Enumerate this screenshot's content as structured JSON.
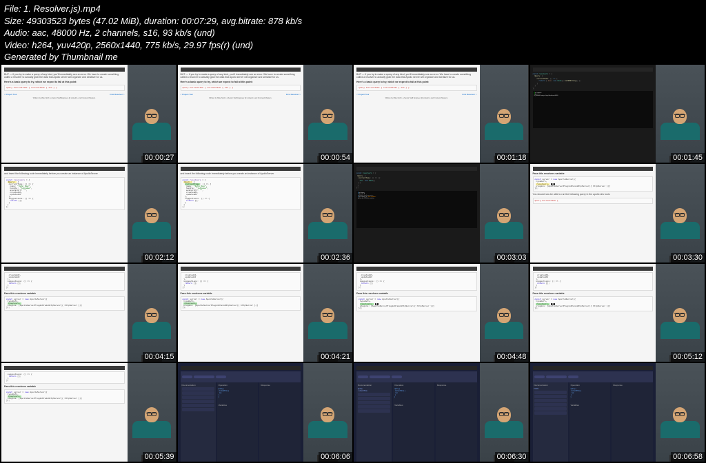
{
  "header": {
    "file": "File: 1. Resolver.js).mp4",
    "size": "Size: 49303523 bytes (47.02 MiB), duration: 00:07:29, avg.bitrate: 878 kb/s",
    "audio": "Audio: aac, 48000 Hz, 2 channels, s16, 93 kb/s (und)",
    "video": "Video: h264, yuv420p, 2560x1440, 775 kb/s, 29.97 fps(r) (und)",
    "generated": "Generated by Thumbnail me"
  },
  "timestamps": [
    "00:00:27",
    "00:00:54",
    "00:01:18",
    "00:01:45",
    "00:02:12",
    "00:02:36",
    "00:03:03",
    "00:03:30",
    "00:04:15",
    "00:04:21",
    "00:04:48",
    "00:05:12",
    "00:05:39",
    "00:06:06",
    "00:06:30",
    "00:06:58"
  ],
  "doc": {
    "intro": "BUT — if you try to make a query of any kind, you'll immediately see an error. We have to create something called a resolver to actually grab the data that Apollo server will organize and serialize for us.",
    "tryLine": "Here's a basic query to try, which we expect to fail at this point:",
    "query": "query CurrentTime {\n  currentTime {\n    iso\n  }\n}",
    "linkLeft": "< Project Tour",
    "linkRight": "First Resolver >",
    "author": "Written by Mike North, a Senior Staff Engineer @ LinkedIn, and Frontend Masters.",
    "insertLine": "and insert the following code immediately before you create an instance of ApolloServer",
    "resolvers": "const resolvers = {\n  Query: {\n    currentTime: () => {\n      const now = new Date();\n      return {\n        name: \"John Doe\",\n        handle: \"johndoe\",\n        avatarUrl: \"\",\n        createdAt: now.toISOString(),\n        updatedAt: now.toISOString()\n      };\n    },\n    suggestions: () => {\n      return [];\n    }\n  }\n};",
    "passLine": "Pass this resolvers variable",
    "serverCode": "const server = new ApolloServer({\n  typeDefs,\n  resolvers,\n  plugins: [ApolloServerPluginDrainHttpServer({ httpServer })]\n});",
    "runLine": "You should now be able to run the following query in the apollo dev tools"
  }
}
